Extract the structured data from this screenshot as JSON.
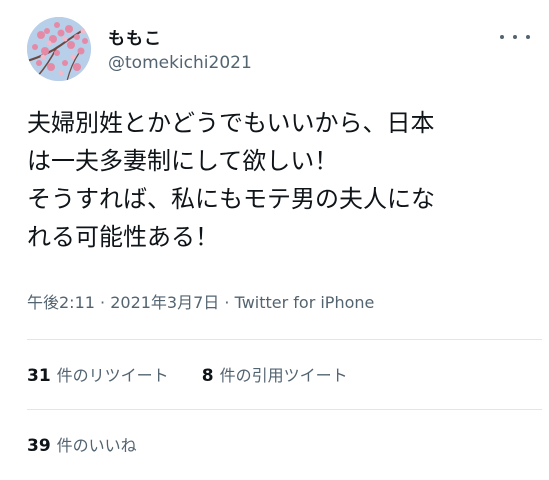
{
  "user": {
    "display_name": "ももこ",
    "handle": "@tomekichi2021",
    "avatar_icon": "cherry-blossom-avatar"
  },
  "more_icon": "more-horizontal-icon",
  "tweet": {
    "lines": [
      "夫婦別姓とかどうでもいいから、日本",
      "は一夫多妻制にして欲しい！",
      "そうすれば、私にもモテ男の夫人にな",
      "れる可能性ある！"
    ]
  },
  "meta": {
    "time": "午後2:11",
    "sep1": " · ",
    "date": "2021年3月7日",
    "sep2": " · ",
    "source": "Twitter for iPhone"
  },
  "stats": {
    "retweets": {
      "count": "31",
      "label": "件のリツイート"
    },
    "quotes": {
      "count": "8",
      "label": "件の引用ツイート"
    },
    "likes": {
      "count": "39",
      "label": "件のいいね"
    }
  },
  "colors": {
    "text_primary": "#0f1419",
    "text_secondary": "#536471",
    "divider": "#e1e6ea"
  }
}
